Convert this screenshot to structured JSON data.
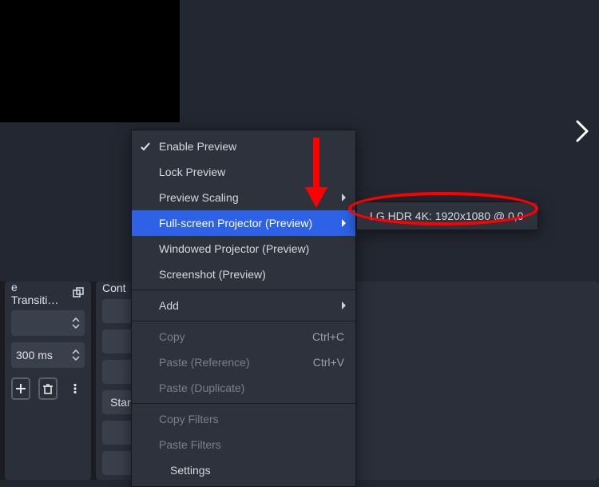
{
  "preview": {},
  "nav": {
    "next_label": "next"
  },
  "transitions": {
    "title": "e Transiti…",
    "duration_value": "300 ms"
  },
  "controls": {
    "title": "Cont",
    "buttons": {
      "start_label": "Star"
    }
  },
  "ctxmenu": {
    "enable_preview": "Enable Preview",
    "enable_preview_checked": true,
    "lock_preview": "Lock Preview",
    "preview_scaling": "Preview Scaling",
    "fullscreen_projector": "Full-screen Projector (Preview)",
    "windowed_projector": "Windowed Projector (Preview)",
    "screenshot_preview": "Screenshot (Preview)",
    "add": "Add",
    "copy": "Copy",
    "copy_shortcut": "Ctrl+C",
    "paste_reference": "Paste (Reference)",
    "paste_reference_shortcut": "Ctrl+V",
    "paste_duplicate": "Paste (Duplicate)",
    "copy_filters": "Copy Filters",
    "paste_filters": "Paste Filters",
    "settings": "Settings"
  },
  "submenu": {
    "display_option": "LG HDR 4K: 1920x1080 @ 0,0"
  },
  "icons": {
    "check": "check-icon",
    "dock_dup": "dock-duplicate-icon",
    "chev_up": "chevron-up-icon",
    "chev_down": "chevron-down-icon",
    "plus": "plus-icon",
    "trash": "trash-icon",
    "dots": "vertical-dots-icon",
    "chev_right": "chevron-right-icon"
  }
}
